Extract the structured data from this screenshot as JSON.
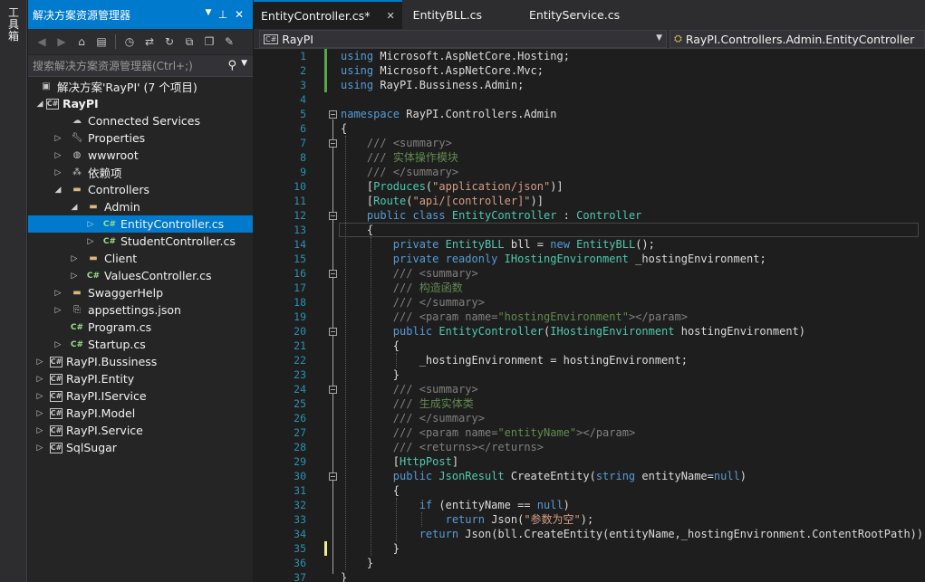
{
  "toolbox": {
    "label": "工具箱"
  },
  "explorer": {
    "title": "解决方案资源管理器",
    "search_placeholder": "搜索解决方案资源管理器(Ctrl+;)",
    "solution": "解决方案'RayPI' (7 个项目)",
    "items": [
      {
        "label": "RayPI",
        "icon": "csharp-project-icon"
      },
      {
        "label": "Connected Services",
        "icon": "connected-services-icon"
      },
      {
        "label": "Properties",
        "icon": "wrench-icon"
      },
      {
        "label": "wwwroot",
        "icon": "globe-icon"
      },
      {
        "label": "依赖项",
        "icon": "dependencies-icon"
      },
      {
        "label": "Controllers",
        "icon": "folder-icon"
      },
      {
        "label": "Admin",
        "icon": "folder-icon"
      },
      {
        "label": "EntityController.cs",
        "icon": "csharp-file-icon"
      },
      {
        "label": "StudentController.cs",
        "icon": "csharp-file-icon"
      },
      {
        "label": "Client",
        "icon": "folder-icon"
      },
      {
        "label": "ValuesController.cs",
        "icon": "csharp-file-icon"
      },
      {
        "label": "SwaggerHelp",
        "icon": "folder-icon"
      },
      {
        "label": "appsettings.json",
        "icon": "json-file-icon"
      },
      {
        "label": "Program.cs",
        "icon": "csharp-file-icon"
      },
      {
        "label": "Startup.cs",
        "icon": "csharp-file-icon"
      },
      {
        "label": "RayPI.Bussiness",
        "icon": "csharp-project-icon"
      },
      {
        "label": "RayPI.Entity",
        "icon": "csharp-project-icon"
      },
      {
        "label": "RayPI.IService",
        "icon": "csharp-project-icon"
      },
      {
        "label": "RayPI.Model",
        "icon": "csharp-project-icon"
      },
      {
        "label": "RayPI.Service",
        "icon": "csharp-project-icon"
      },
      {
        "label": "SqlSugar",
        "icon": "csharp-project-icon"
      }
    ]
  },
  "editor": {
    "tabs": [
      {
        "label": "EntityController.cs*",
        "active": true
      },
      {
        "label": "EntityBLL.cs",
        "active": false
      },
      {
        "label": "EntityService.cs",
        "active": false
      }
    ],
    "nav_project": "RayPI",
    "nav_member": "RayPI.Controllers.Admin.EntityController",
    "csharp_badge": "C#",
    "line_numbers": [
      "1",
      "2",
      "3",
      "4",
      "5",
      "6",
      "7",
      "8",
      "9",
      "10",
      "11",
      "12",
      "13",
      "14",
      "15",
      "16",
      "17",
      "18",
      "19",
      "20",
      "21",
      "22",
      "23",
      "24",
      "25",
      "26",
      "27",
      "28",
      "29",
      "30",
      "31",
      "32",
      "33",
      "34",
      "35",
      "36",
      "37"
    ],
    "code_lines": [
      "using Microsoft.AspNetCore.Hosting;",
      "using Microsoft.AspNetCore.Mvc;",
      "using RayPI.Bussiness.Admin;",
      "",
      "namespace RayPI.Controllers.Admin",
      "{",
      "    /// <summary>",
      "    /// 实体操作模块",
      "    /// </summary>",
      "    [Produces(\"application/json\")]",
      "    [Route(\"api/[controller]\")]",
      "    public class EntityController : Controller",
      "    {",
      "        private EntityBLL bll = new EntityBLL();",
      "        private readonly IHostingEnvironment _hostingEnvironment;",
      "        /// <summary>",
      "        /// 构造函数",
      "        /// </summary>",
      "        /// <param name=\"hostingEnvironment\"></param>",
      "        public EntityController(IHostingEnvironment hostingEnvironment)",
      "        {",
      "            _hostingEnvironment = hostingEnvironment;",
      "        }",
      "        /// <summary>",
      "        /// 生成实体类",
      "        /// </summary>",
      "        /// <param name=\"entityName\"></param>",
      "        /// <returns></returns>",
      "        [HttpPost]",
      "        public JsonResult CreateEntity(string entityName=null)",
      "        {",
      "            if (entityName == null)",
      "                return Json(\"参数为空\");",
      "            return Json(bll.CreateEntity(entityName,_hostingEnvironment.ContentRootPath));",
      "        }",
      "    }",
      "}"
    ]
  },
  "colors": {
    "accent": "#007acc",
    "keyword": "#569cd6",
    "type": "#4ec9b0",
    "string": "#d69d85",
    "comment": "#57a64a",
    "line_number": "#2b91af"
  }
}
